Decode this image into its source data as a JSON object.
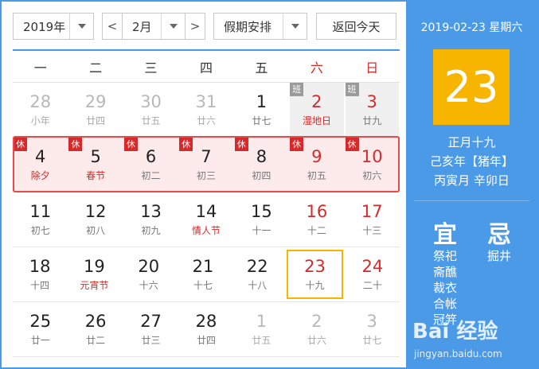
{
  "toolbar": {
    "year": "2019年",
    "prev": "<",
    "month": "2月",
    "next": ">",
    "holiday": "假期安排",
    "today_button": "返回今天"
  },
  "weekdays": [
    "一",
    "二",
    "三",
    "四",
    "五",
    "六",
    "日"
  ],
  "weeks": [
    [
      {
        "n": "28",
        "l": "小年",
        "type": "other"
      },
      {
        "n": "29",
        "l": "廿四",
        "type": "other"
      },
      {
        "n": "30",
        "l": "廿五",
        "type": "other"
      },
      {
        "n": "31",
        "l": "廿六",
        "type": "other"
      },
      {
        "n": "1",
        "l": "廿七",
        "type": "normal"
      },
      {
        "n": "2",
        "l": "湿地日",
        "type": "workday",
        "tag": "班",
        "red": true,
        "festival": true
      },
      {
        "n": "3",
        "l": "廿九",
        "type": "workday",
        "tag": "班",
        "red": true
      }
    ],
    [
      {
        "n": "4",
        "l": "除夕",
        "type": "holiday",
        "tag": "休",
        "festival": true
      },
      {
        "n": "5",
        "l": "春节",
        "type": "holiday",
        "tag": "休",
        "festival": true
      },
      {
        "n": "6",
        "l": "初二",
        "type": "holiday",
        "tag": "休"
      },
      {
        "n": "7",
        "l": "初三",
        "type": "holiday",
        "tag": "休"
      },
      {
        "n": "8",
        "l": "初四",
        "type": "holiday",
        "tag": "休"
      },
      {
        "n": "9",
        "l": "初五",
        "type": "holiday",
        "tag": "休",
        "red": true
      },
      {
        "n": "10",
        "l": "初六",
        "type": "holiday",
        "tag": "休",
        "red": true
      }
    ],
    [
      {
        "n": "11",
        "l": "初七",
        "type": "normal"
      },
      {
        "n": "12",
        "l": "初八",
        "type": "normal"
      },
      {
        "n": "13",
        "l": "初九",
        "type": "normal"
      },
      {
        "n": "14",
        "l": "情人节",
        "type": "normal",
        "festival": true
      },
      {
        "n": "15",
        "l": "十一",
        "type": "normal"
      },
      {
        "n": "16",
        "l": "十二",
        "type": "normal",
        "red": true
      },
      {
        "n": "17",
        "l": "十三",
        "type": "normal",
        "red": true
      }
    ],
    [
      {
        "n": "18",
        "l": "十四",
        "type": "normal"
      },
      {
        "n": "19",
        "l": "元宵节",
        "type": "normal",
        "festival": true
      },
      {
        "n": "20",
        "l": "十六",
        "type": "normal"
      },
      {
        "n": "21",
        "l": "十七",
        "type": "normal"
      },
      {
        "n": "22",
        "l": "十八",
        "type": "normal"
      },
      {
        "n": "23",
        "l": "十九",
        "type": "today",
        "red": true
      },
      {
        "n": "24",
        "l": "二十",
        "type": "normal",
        "red": true
      }
    ],
    [
      {
        "n": "25",
        "l": "廿一",
        "type": "normal"
      },
      {
        "n": "26",
        "l": "廿二",
        "type": "normal"
      },
      {
        "n": "27",
        "l": "廿三",
        "type": "normal"
      },
      {
        "n": "28",
        "l": "廿四",
        "type": "normal"
      },
      {
        "n": "1",
        "l": "廿五",
        "type": "other"
      },
      {
        "n": "2",
        "l": "廿六",
        "type": "other"
      },
      {
        "n": "3",
        "l": "廿七",
        "type": "other"
      }
    ]
  ],
  "side": {
    "date": "2019-02-23 星期六",
    "day": "23",
    "lunar": "正月十九",
    "ganzhi_year": "己亥年【猪年】",
    "ganzhi_md": "丙寅月 辛卯日",
    "yi": "宜",
    "ji": "忌",
    "yi_items": [
      "祭祀",
      "斋醮",
      "裁衣",
      "合帐",
      "冠笄"
    ],
    "ji_items": [
      "掘井"
    ]
  },
  "watermark": {
    "brand": "Bai 经验",
    "url": "jingyan.baidu.com"
  },
  "colors": {
    "accent": "#4a9ae8",
    "today": "#f7b500",
    "holiday_red": "#d62a2a"
  }
}
